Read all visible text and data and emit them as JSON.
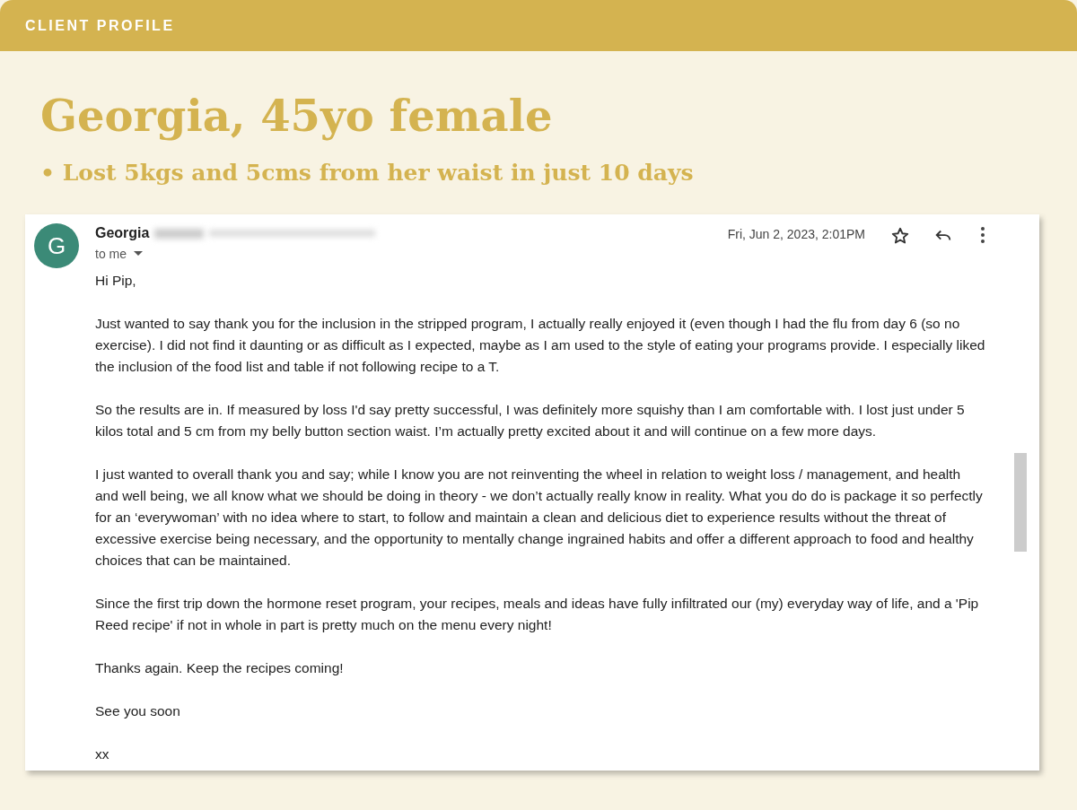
{
  "header": {
    "label": "CLIENT PROFILE"
  },
  "title": "Georgia, 45yo female",
  "subtitle": "• Lost 5kgs and 5cms from her waist in just 10 days",
  "email": {
    "avatar": "G",
    "sender": "Georgia",
    "recipient": "to me",
    "date": "Fri, Jun 2, 2023, 2:01PM",
    "paragraphs": [
      "Hi Pip,",
      "Just wanted to say thank you for the inclusion in the stripped program, I actually really enjoyed it (even though I had the flu from day 6 (so no exercise). I did not find it daunting or as difficult as I expected, maybe as I am used to the style of eating your programs provide. I especially liked the inclusion of the food list and table if not following recipe to a T.",
      "So the results are in. If measured by loss I'd say pretty successful, I was definitely more squishy than I am comfortable with. I lost just under 5 kilos total and 5 cm from my belly button section waist. I’m actually pretty excited about it and will continue on a few more days.",
      "I just wanted to overall thank you and say; while I know you are not reinventing the wheel in relation to weight loss / management, and health and well being, we all know what we should be doing in theory - we don’t actually really know in reality. What you do do is package it so perfectly for an ‘everywoman’ with no idea where to start, to follow and maintain a clean and delicious diet to experience results without the threat of excessive exercise being necessary, and the opportunity to mentally change ingrained habits and offer a different approach to food and healthy choices that can be maintained.",
      "Since the first trip down the hormone reset program, your recipes, meals and ideas have fully infiltrated our (my) everyday way of life, and a 'Pip Reed recipe' if not in whole in part is pretty much on the menu every night!",
      "Thanks again. Keep the recipes coming!",
      "See you soon",
      "xx"
    ]
  }
}
